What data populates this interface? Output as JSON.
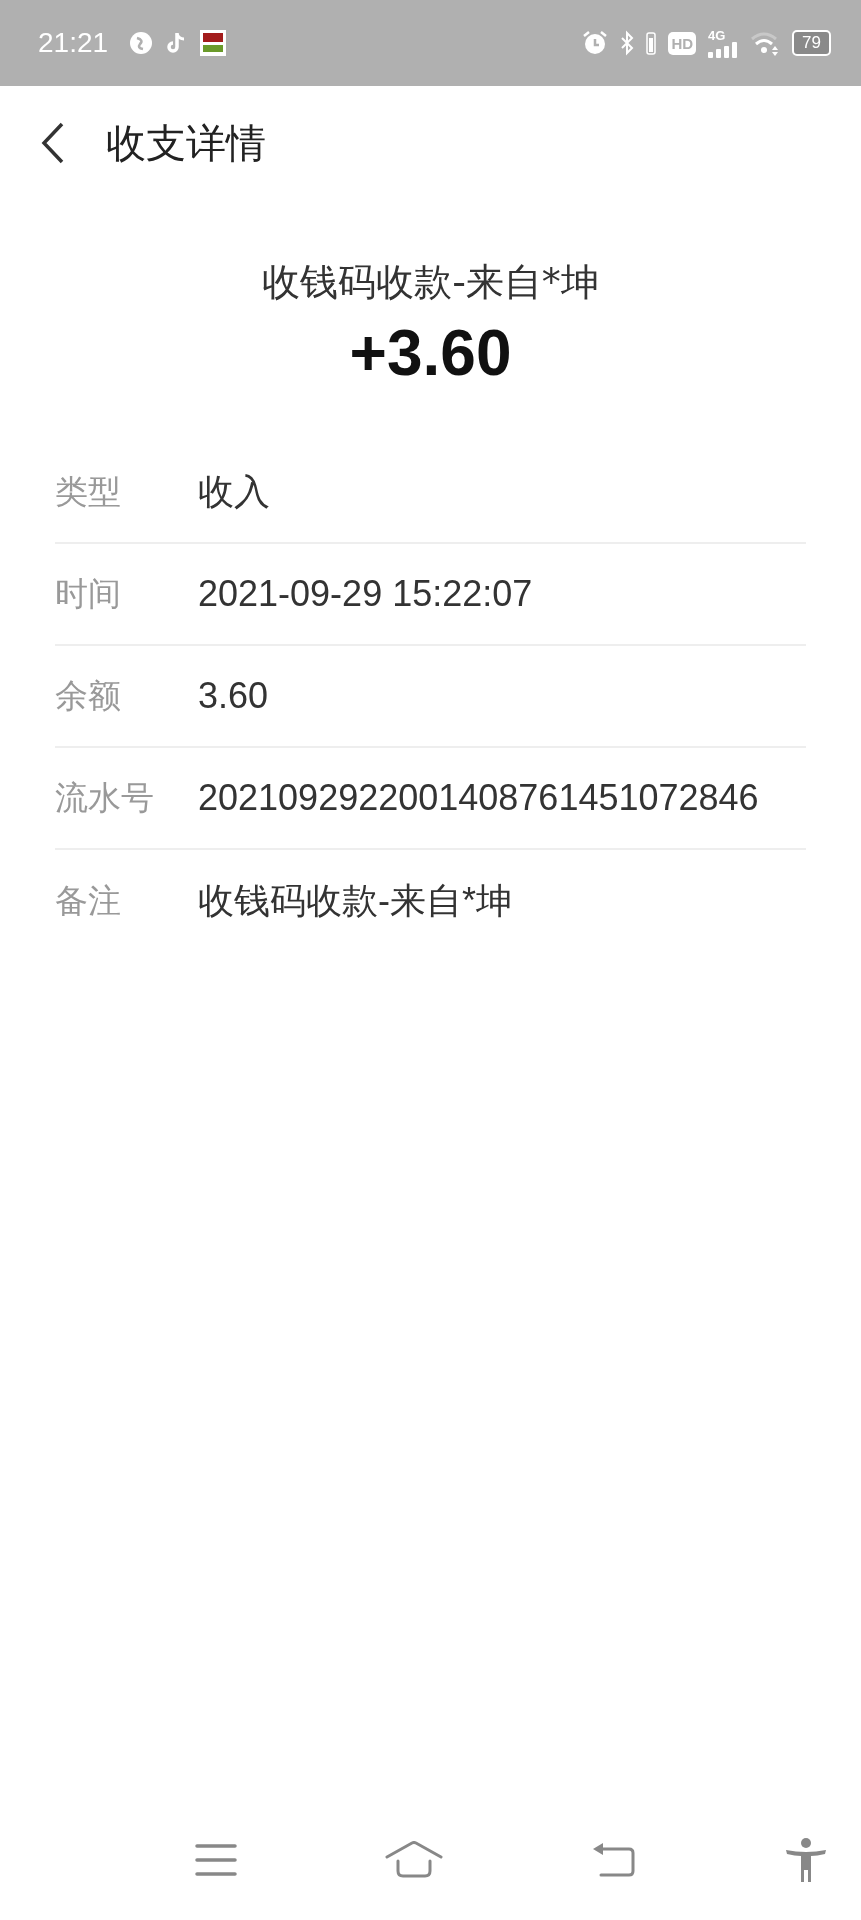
{
  "status_bar": {
    "time": "21:21",
    "network": "4G",
    "hd": "HD",
    "battery": "79"
  },
  "header": {
    "title": "收支详情"
  },
  "summary": {
    "description": "收钱码收款-来自*坤",
    "amount": "+3.60"
  },
  "details": [
    {
      "label": "类型",
      "value": "收入"
    },
    {
      "label": "时间",
      "value": "2021-09-29 15:22:07"
    },
    {
      "label": "余额",
      "value": "3.60"
    },
    {
      "label": "流水号",
      "value": "2021092922001408761451072846"
    },
    {
      "label": "备注",
      "value": "收钱码收款-来自*坤"
    }
  ]
}
